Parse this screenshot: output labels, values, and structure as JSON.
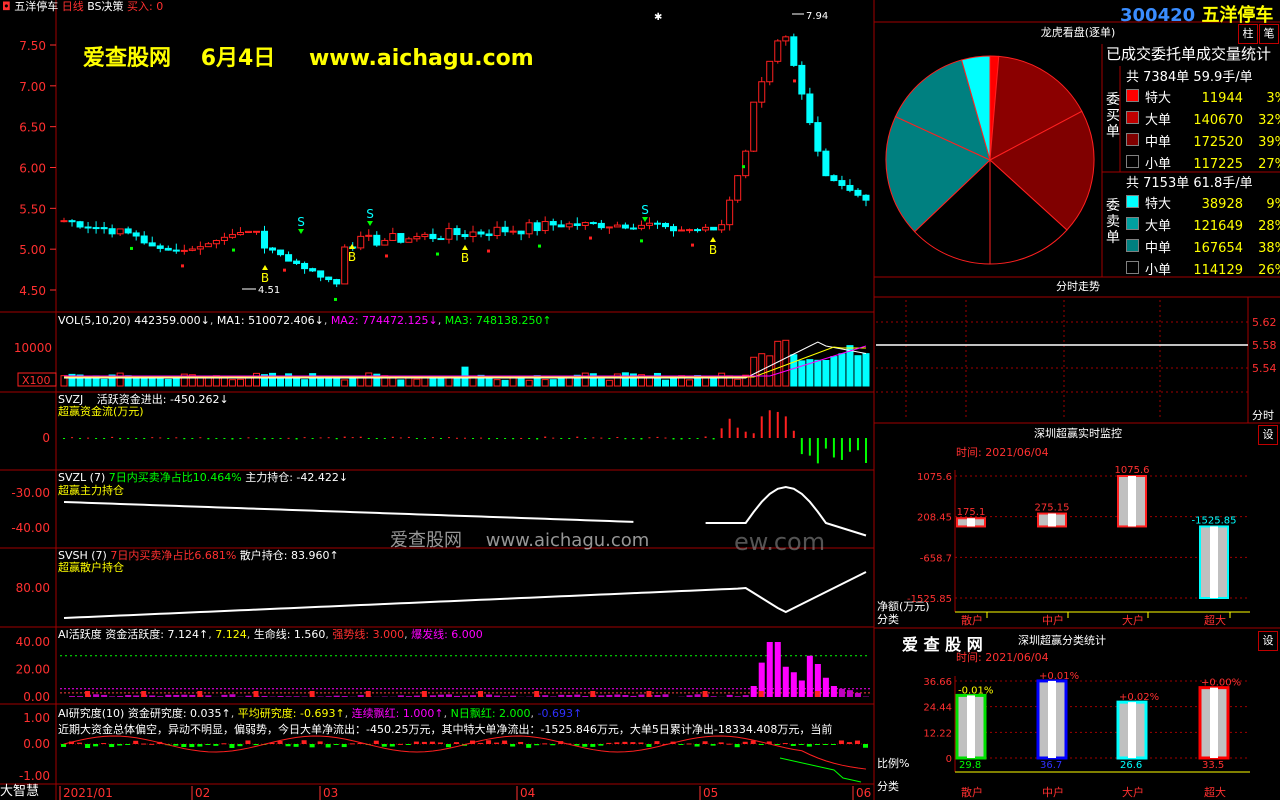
{
  "header": {
    "stock_name": "五洋停车",
    "period": "日线",
    "strategy": "BS决策",
    "signal": "买入: 0",
    "watermark_site": "爱查股网",
    "watermark_date": "6月4日",
    "watermark_url": "www.aichagu.com",
    "center_watermark_site": "爱查股网",
    "center_watermark_url": "www.aichagu.com",
    "center_watermark_tail": "ew.com"
  },
  "price_chart": {
    "y_ticks": [
      "7.50",
      "7.00",
      "6.50",
      "6.00",
      "5.50",
      "5.00",
      "4.50"
    ],
    "high_label": "7.94",
    "low_label": "4.51",
    "markers": [
      "S",
      "S",
      "S",
      "B",
      "B",
      "B",
      "B",
      "B"
    ]
  },
  "vol_panel": {
    "title": "VOL(5,10,20)",
    "value": "442359.000↓",
    "ma1": "MA1: 510072.406↓",
    "ma2": "MA2: 774472.125↓",
    "ma3": "MA3: 748138.250↑",
    "y_tick": "10000",
    "unit": "X100"
  },
  "svzj_panel": {
    "title": "SVZJ",
    "label": "活跃资金进出: -450.262↓",
    "sub": "超赢资金流(万元)",
    "y_tick": "0"
  },
  "svzl_panel": {
    "title": "SVZL (7)",
    "label1": "7日内买卖净占比10.464%",
    "label2": "主力持仓: -42.422↓",
    "sub": "超赢主力持仓",
    "y_ticks": [
      "-30.00",
      "-40.00"
    ]
  },
  "svsh_panel": {
    "title": "SVSH (7)",
    "label1": "7日内买卖净占比6.681%",
    "label2": "散户持仓: 83.960↑",
    "sub": "超赢散户持仓",
    "y_tick": "80.00"
  },
  "ai_panel": {
    "title": "AI活跃度",
    "label1": "资金活跃度: 7.124↑",
    "label2": "7.124",
    "label3": "生命线: 1.560",
    "label4": "强势线: 3.000",
    "label5": "爆发线: 6.000",
    "y_ticks": [
      "40.00",
      "20.00",
      "0.00"
    ]
  },
  "research_panel": {
    "title": "AI研究度(10)",
    "label1": "资金研究度: 0.035↑",
    "label2": "平均研究度: -0.693↑",
    "label3": "连续飘红: 1.000↑",
    "label4": "N日飘红: 2.000",
    "label5": "-0.693↑",
    "commentary": "近期大资金总体偏空，异动不明显，偏弱势，今日大单净流出：-450.25万元，其中特大单净流出：-1525.846万元，大单5日累计净出-18334.408万元，当前",
    "y_ticks": [
      "1.00",
      "0.00",
      "-1.00"
    ]
  },
  "x_axis": {
    "brand": "大智慧",
    "labels": [
      "2021/01",
      "02",
      "03",
      "04",
      "05",
      "06"
    ]
  },
  "right_panel": {
    "code": "300420",
    "name": "五洋停车",
    "btn1": "柱",
    "btn2": "笔",
    "lhkp_title": "龙虎看盘(逐单)",
    "stats_title": "已成交委托单成交量统计",
    "buy_side": {
      "label": "委买单",
      "total": "共 7384单 59.9手/单",
      "rows": [
        {
          "name": "特大",
          "value": "11944",
          "pct": "3%",
          "color": "#ff0000"
        },
        {
          "name": "大单",
          "value": "140670",
          "pct": "32%",
          "color": "#c00000"
        },
        {
          "name": "中单",
          "value": "172520",
          "pct": "39%",
          "color": "#800000"
        },
        {
          "name": "小单",
          "value": "117225",
          "pct": "27%",
          "color": "#000000"
        }
      ]
    },
    "sell_side": {
      "label": "委卖单",
      "total": "共 7153单 61.8手/单",
      "rows": [
        {
          "name": "特大",
          "value": "38928",
          "pct": "9%",
          "color": "#00ffff"
        },
        {
          "name": "大单",
          "value": "121649",
          "pct": "28%",
          "color": "#00a0a0"
        },
        {
          "name": "中单",
          "value": "167654",
          "pct": "38%",
          "color": "#008080"
        },
        {
          "name": "小单",
          "value": "114129",
          "pct": "26%",
          "color": "#000000"
        }
      ]
    },
    "intraday_title": "分时走势",
    "intraday_ticks": [
      "5.62",
      "5.58",
      "5.54"
    ],
    "intraday_label": "分时",
    "monitor_title": "深圳超赢实时监控",
    "monitor_btn": "设",
    "monitor_time": "时间: 2021/06/04",
    "monitor_y": [
      "1075.6",
      "208.45",
      "-658.7",
      "-1525.85"
    ],
    "monitor_bars": [
      {
        "cat": "散户",
        "value": 175.1,
        "label": "175.1"
      },
      {
        "cat": "中户",
        "value": 275.15,
        "label": "275.15"
      },
      {
        "cat": "大户",
        "value": 1075.6,
        "label": "1075.6"
      },
      {
        "cat": "超大",
        "value": -1525.85,
        "label": "-1525.85"
      }
    ],
    "monitor_unit": "净额(万元)",
    "monitor_cat": "分类",
    "stats2_brand": "爱 查 股 网",
    "stats2_title": "深圳超赢分类统计",
    "stats2_btn": "设",
    "stats2_time": "时间: 2021/06/04",
    "stats2_y": [
      "36.66",
      "24.44",
      "12.22",
      "0"
    ],
    "stats2_bars": [
      {
        "cat": "散户",
        "value": 29.8,
        "label": "29.8",
        "delta": "-0.01%",
        "color": "#00e000"
      },
      {
        "cat": "中户",
        "value": 36.7,
        "label": "36.7",
        "delta": "+0.01%",
        "color": "#0000ff"
      },
      {
        "cat": "大户",
        "value": 26.6,
        "label": "26.6",
        "delta": "+0.02%",
        "color": "#00ffff"
      },
      {
        "cat": "超大",
        "value": 33.5,
        "label": "33.5",
        "delta": "+0.00%",
        "color": "#ff0000"
      }
    ],
    "stats2_unit": "比例%",
    "stats2_cat": "分类"
  },
  "colors": {
    "up": "#ff2020",
    "down": "#00ffff",
    "grid": "#800000",
    "text": "#c0c0c0"
  }
}
